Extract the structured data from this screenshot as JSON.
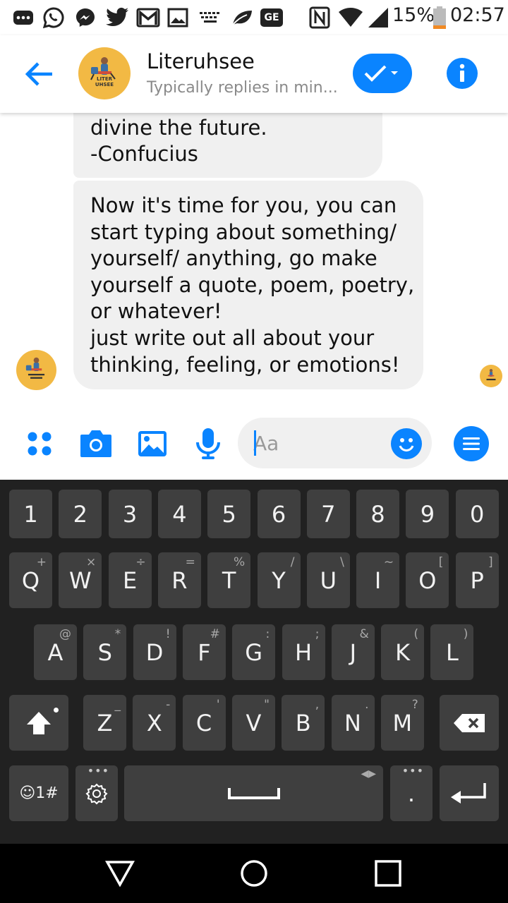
{
  "status_bar": {
    "battery": "15%",
    "time": "02:57",
    "icons": [
      "more-icon",
      "whatsapp-icon",
      "messenger-icon",
      "twitter-icon",
      "gmail-icon",
      "gallery-icon",
      "keyboard-icon",
      "leaf-icon",
      "ge-badge-icon",
      "nfc-icon",
      "wifi-icon",
      "signal-icon",
      "battery-icon"
    ],
    "ge_badge": "GE"
  },
  "header": {
    "contact_name": "Literuhsee",
    "contact_status": "Typically replies in min...",
    "avatar_text": [
      "LITER",
      "UHSEE"
    ],
    "accent": "#0a84ff"
  },
  "messages": [
    {
      "sender": "Literuhsee",
      "text": "divine the future.\n-Confucius"
    },
    {
      "sender": "Literuhsee",
      "text": "Now it's time for you, you can\nstart typing about something/\nyourself/ anything, go make\nyourself a quote, poem, poetry,\nor whatever!\njust write out all about your\nthinking, feeling, or emotions!"
    }
  ],
  "composer": {
    "placeholder": "Aa",
    "icons": [
      "apps-icon",
      "camera-icon",
      "image-icon",
      "microphone-icon",
      "emoji-icon",
      "menu-icon"
    ]
  },
  "keyboard": {
    "number_row": [
      "1",
      "2",
      "3",
      "4",
      "5",
      "6",
      "7",
      "8",
      "9",
      "0"
    ],
    "row1": [
      {
        "k": "Q",
        "h": "+"
      },
      {
        "k": "W",
        "h": "×"
      },
      {
        "k": "E",
        "h": "÷"
      },
      {
        "k": "R",
        "h": "="
      },
      {
        "k": "T",
        "h": "%"
      },
      {
        "k": "Y",
        "h": "/"
      },
      {
        "k": "U",
        "h": "\\"
      },
      {
        "k": "I",
        "h": "~"
      },
      {
        "k": "O",
        "h": "["
      },
      {
        "k": "P",
        "h": "]"
      }
    ],
    "row2": [
      {
        "k": "A",
        "h": "@"
      },
      {
        "k": "S",
        "h": "*"
      },
      {
        "k": "D",
        "h": "!"
      },
      {
        "k": "F",
        "h": "#"
      },
      {
        "k": "G",
        "h": ":"
      },
      {
        "k": "H",
        "h": ";"
      },
      {
        "k": "J",
        "h": "&"
      },
      {
        "k": "K",
        "h": "("
      },
      {
        "k": "L",
        "h": ")"
      }
    ],
    "row3": [
      {
        "k": "Z",
        "h": "_"
      },
      {
        "k": "X",
        "h": "-"
      },
      {
        "k": "C",
        "h": "'"
      },
      {
        "k": "V",
        "h": "\""
      },
      {
        "k": "B",
        "h": ","
      },
      {
        "k": "N",
        "h": "."
      },
      {
        "k": "M",
        "h": "?"
      }
    ],
    "symbols_key": "☺1#",
    "period_key": ".",
    "more_dots": "•••"
  },
  "nav_bar": {
    "icons": [
      "back-triangle-icon",
      "home-circle-icon",
      "recents-square-icon"
    ]
  }
}
